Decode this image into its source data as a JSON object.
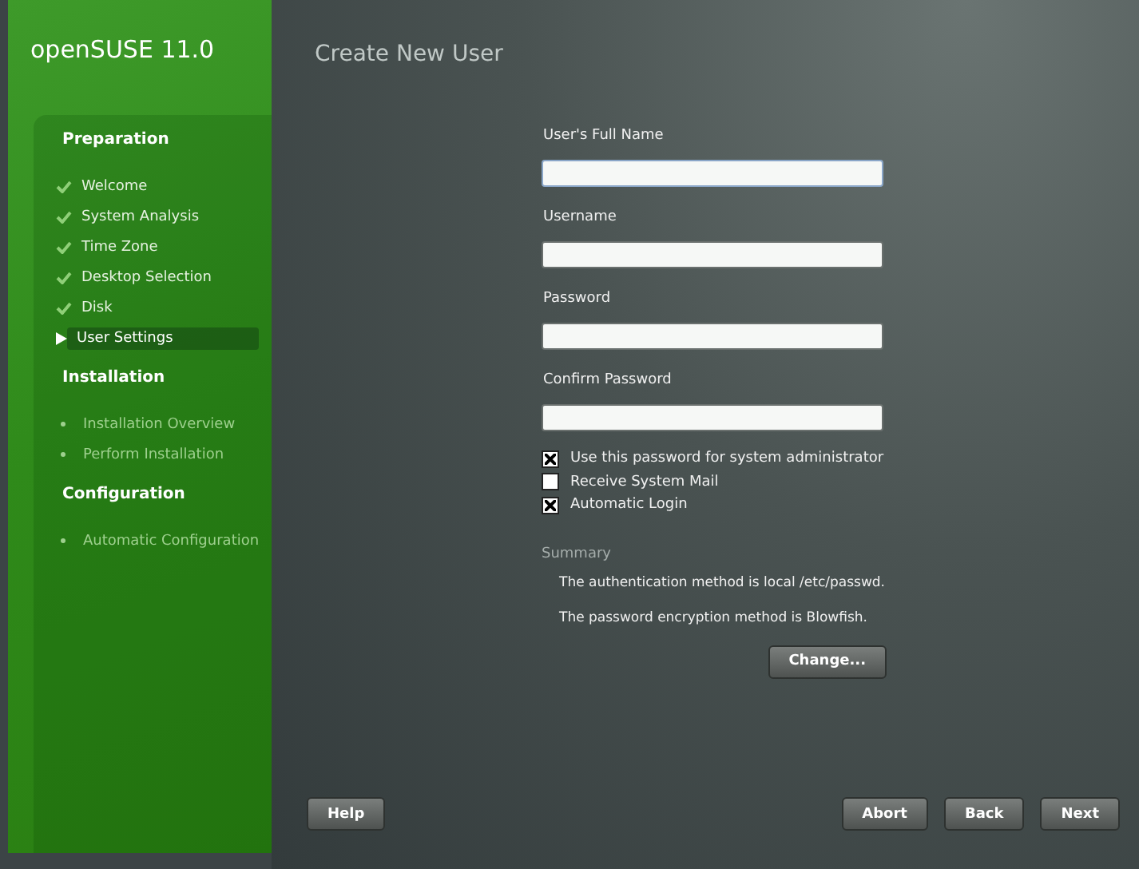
{
  "brand": "openSUSE 11.0",
  "steps": [
    {
      "title": "Preparation",
      "items": [
        {
          "label": "Welcome",
          "kind": "done",
          "selected": false
        },
        {
          "label": "System Analysis",
          "kind": "done",
          "selected": false
        },
        {
          "label": "Time Zone",
          "kind": "done",
          "selected": false
        },
        {
          "label": "Desktop Selection",
          "kind": "done",
          "selected": false
        },
        {
          "label": "Disk",
          "kind": "done",
          "selected": false
        },
        {
          "label": "User Settings",
          "kind": "current",
          "selected": true
        }
      ]
    },
    {
      "title": "Installation",
      "items": [
        {
          "label": "Installation Overview",
          "kind": "pending",
          "selected": false
        },
        {
          "label": "Perform Installation",
          "kind": "pending",
          "selected": false
        }
      ]
    },
    {
      "title": "Configuration",
      "items": [
        {
          "label": "Automatic Configuration",
          "kind": "pending",
          "selected": false
        }
      ]
    }
  ],
  "page_title": "Create New User",
  "fields": [
    {
      "label": "User's Full Name",
      "focused": true
    },
    {
      "label": "Username",
      "focused": false
    },
    {
      "label": "Password",
      "focused": false
    },
    {
      "label": "Confirm Password",
      "focused": false
    }
  ],
  "checkboxes": [
    {
      "label": "Use this password for system administrator",
      "checked": true
    },
    {
      "label": "Receive System Mail",
      "checked": false
    },
    {
      "label": "Automatic Login",
      "checked": true
    }
  ],
  "summary": {
    "title": "Summary",
    "lines": [
      "The authentication method is local /etc/passwd.",
      "The password encryption method is Blowfish."
    ],
    "button": "Change..."
  },
  "footer": {
    "left": [
      "Help"
    ],
    "right": [
      "Abort",
      "Back",
      "Next"
    ]
  }
}
